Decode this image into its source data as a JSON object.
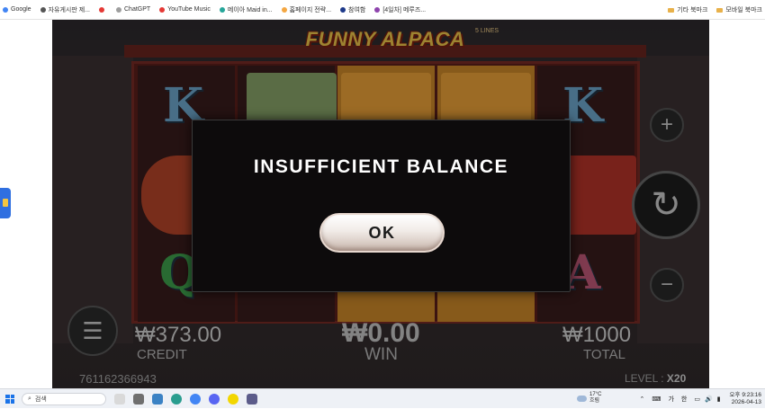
{
  "bookmarks": {
    "items": [
      {
        "label": "Google",
        "color": "#4285f4"
      },
      {
        "label": "자유게시판 제...",
        "color": "#555555"
      },
      {
        "label": "",
        "color": "#e53935"
      },
      {
        "label": "ChatGPT",
        "color": "#9e9e9e"
      },
      {
        "label": "YouTube Music",
        "color": "#e53935"
      },
      {
        "label": "메이아 Maid in...",
        "color": "#26a69a"
      },
      {
        "label": "홈페이지 전략...",
        "color": "#f4a742"
      },
      {
        "label": "참여함",
        "color": "#1e3a8a"
      },
      {
        "label": "[4일차] 메루즈...",
        "color": "#8e44ad"
      }
    ],
    "right": [
      {
        "label": "기타 북마크"
      },
      {
        "label": "모바일 북마크"
      }
    ]
  },
  "game": {
    "title": "FUNNY ALPACA",
    "lines_label": "5 LINES",
    "credit_value": "₩373.00",
    "credit_label": "CREDIT",
    "win_value": "₩0.00",
    "win_label": "WIN",
    "total_value": "₩1000",
    "total_label": "TOTAL",
    "game_id": "761162366943",
    "level_label": "LEVEL : ",
    "level_value": "X20",
    "reel_letters": [
      "K",
      "K",
      "Q",
      "A"
    ]
  },
  "modal": {
    "message": "INSUFFICIENT BALANCE",
    "ok_label": "OK"
  },
  "taskbar": {
    "search_placeholder": "검색",
    "weather_temp": "17°C",
    "weather_desc": "흐림",
    "ime_1": "가",
    "ime_2": "한",
    "time": "오후 9:23:16",
    "date": "2026-04-13"
  }
}
